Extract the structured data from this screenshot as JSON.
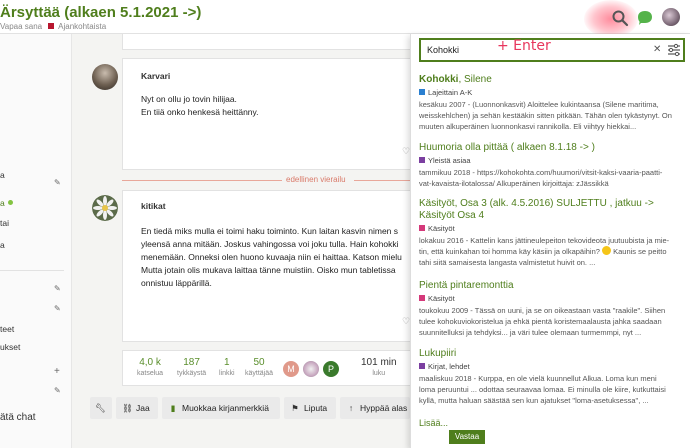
{
  "header": {
    "topic_title": "Ärsyttää (alkaen 5.1.2021 ->)",
    "sub_left": "Vapaa sana",
    "sub_category": "Ajankohtaista"
  },
  "sidebar": {
    "item_a": "a",
    "item_a2": "a",
    "item_tai": "tai",
    "item_a3": "a",
    "item_teet": "teet",
    "item_ukset": "ukset",
    "item_chat": "ätä chat"
  },
  "posts": [
    {
      "author": "Karvari",
      "lines": [
        "Nyt on ollu jo tovin hilijaa.",
        "En tiiä onko henkesä heittänny."
      ]
    },
    {
      "author": "kitikat",
      "lines": [
        "En tiedä miks mulla ei toimi haku toiminto. Kun laitan kasvin nimen s",
        "yleensä anna mitään. Joskus vahingossa voi joku tulla. Hain kohokki",
        "menemään. Onneksi olen huono kuvaaja niin ei haittaa. Katson mielu",
        "Mutta jotain olis mukava laittaa tänne muistiin. Oisko mun tabletissa",
        "onnistuu läppärillä."
      ]
    }
  ],
  "divider_label": "edellinen vierailu",
  "stats": [
    {
      "num": "4,0 k",
      "label": "katselua"
    },
    {
      "num": "187",
      "label": "tykkäystä"
    },
    {
      "num": "1",
      "label": "linkki"
    },
    {
      "num": "50",
      "label": "käyttäjää"
    },
    {
      "num": "101 min",
      "label": "luku"
    }
  ],
  "participants": [
    "M",
    "P"
  ],
  "buttons": {
    "share": "Jaa",
    "bookmark": "Muokkaa kirjanmerkkiä",
    "flag": "Liputa",
    "jump": "Hyppää alas"
  },
  "search": {
    "value": "Kohokki",
    "annotation": "+ Enter",
    "results": [
      {
        "title": "Kohokki, Silene",
        "title_bold": "Kohokki",
        "title_rest": ", Silene",
        "category": "Lajeittain A-K",
        "cat_color": "#2a7fd0",
        "blurb": [
          "kesäkuu 2007 - (Luonnonkasvit) Aloittelee kukintaansa (Silene maritima,",
          "weisskehlchen) ja sehän kestääkin sitten pitkään. Tähän olen tykästynyt. On",
          "muuten alkuperäinen luonnonkasvi rannikolla. Eli viihtyy hiekkai..."
        ]
      },
      {
        "title": "Huumoria olla pittää ( alkaen 8.1.18 -> )",
        "category": "Yleistä asiaa",
        "cat_color": "#7b3fa0",
        "blurb": [
          "tammikuu 2018 - https://kohokohta.com/huumori/vitsit-kaksi-vaaria-paatti-",
          "vat-kavaista-ilotalossa/ Alkuperäinen kirjoittaja: zJässikkä"
        ]
      },
      {
        "title": "Käsityöt, Osa 3 (alk. 4.5.2016) SULJETTU , jatkuu -> Käsityöt Osa 4",
        "title_line1": "Käsityöt, Osa 3 (alk. 4.5.2016) SULJETTU , jatkuu ->",
        "title_line2": "Käsityöt Osa 4",
        "category": "Käsityöt",
        "cat_color": "#d4397a",
        "blurb": [
          "lokakuu 2016 - Kattelin kans jättineulepeiton tekovideota juutuubista ja mie-",
          "tin, että kuinkahan toi homma käy käsiin ja olkapäihin?",
          "tahi siitä samaisesta langasta valmistetut huivit on. ..."
        ],
        "blurb2_tail": "Kaunis se peitto"
      },
      {
        "title": "Pientä pintaremonttia",
        "category": "Käsityöt",
        "cat_color": "#d4397a",
        "blurb": [
          "toukokuu 2009 - Tässä on uuni, ja se on oikeastaan vasta \"raakile\". Siihen",
          "tulee kohokuviokoristelua ja ehkä pientä koristemaalausta jahka saadaan",
          "suunnitelluksi ja tehdyksi... ja väri tulee olemaan turmemmpi, nyt ..."
        ]
      },
      {
        "title": "Lukupiiri",
        "category": "Kirjat, lehdet",
        "cat_color": "#7b3fa0",
        "blurb": [
          "maaliskuu 2018 - Kurppa, en ole vielä kuunnellut Alkua. Loma kun meni",
          "loma peruuntui ... odottaa seuraavaa lomaa. Ei minulla ole kiire, kutkuttaisi",
          "kyllä, mutta haluan säästää sen kun ajatukset \"loma-asetuksessa\", ..."
        ]
      }
    ],
    "more": "Lisää...",
    "reply_label": "Vastaa"
  },
  "colors": {
    "brand_green": "#4f7e1c",
    "annotation_pink": "#e8365d"
  }
}
